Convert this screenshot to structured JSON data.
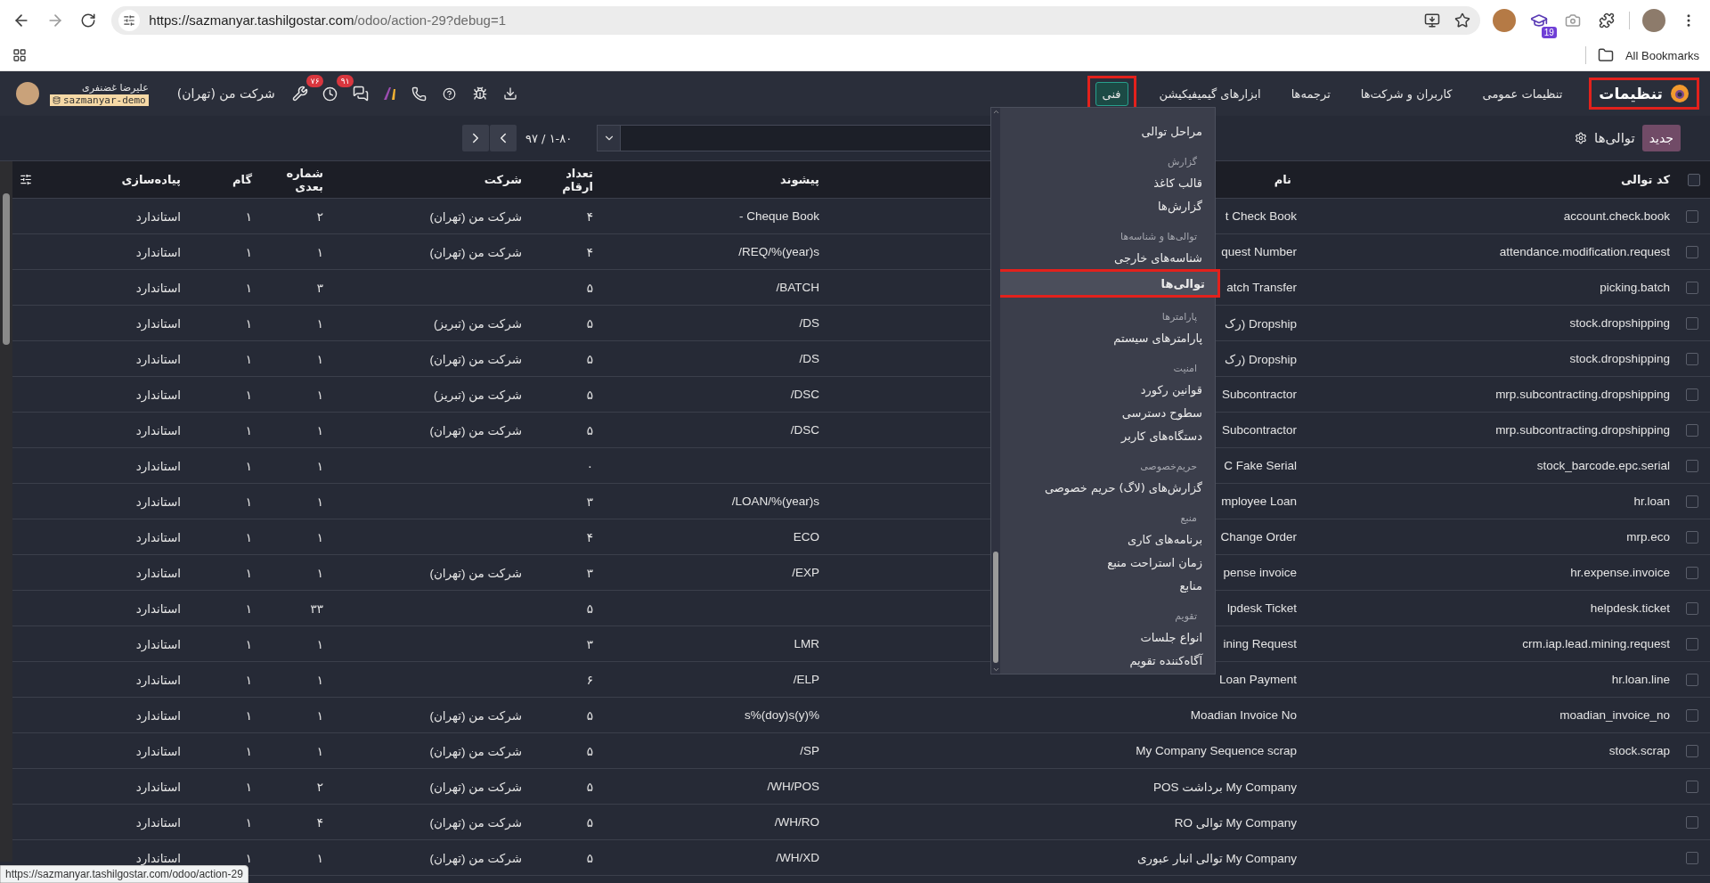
{
  "browser": {
    "url_host": "https://sazmanyar.tashilgostar.com",
    "url_path": "/odoo/action-29?debug=1",
    "extension_badge": "19",
    "bookmarks_label": "All Bookmarks"
  },
  "navbar": {
    "app": {
      "label": "تنظیمات",
      "annotated": true
    },
    "menu": [
      {
        "label": "تنظیمات عمومی",
        "selected": false,
        "annotated": false
      },
      {
        "label": "کاربران و شرکت‌ها",
        "selected": false,
        "annotated": false
      },
      {
        "label": "ترجمه‌ها",
        "selected": false,
        "annotated": false
      },
      {
        "label": "ابزارهای گیمیفیکیشن",
        "selected": false,
        "annotated": false
      },
      {
        "label": "فنی",
        "selected": true,
        "annotated": true
      }
    ],
    "systray": {
      "chat_count": "۹۱",
      "activity_count": "۷۶",
      "company": "شرکت من (تهران)",
      "user_name": "علیرضا غضنفری",
      "database": "sazmanyar-demo"
    }
  },
  "control_panel": {
    "new_button": "جدید",
    "breadcrumb": "توالی‌ها",
    "pager": "۱-۸۰ / ۹۷"
  },
  "menu_dropdown": {
    "items": [
      {
        "kind": "item",
        "label": "مراحل توالی",
        "selected": false,
        "annotated": false
      },
      {
        "kind": "header",
        "label": "گزارش"
      },
      {
        "kind": "item",
        "label": "قالب کاغذ",
        "selected": false,
        "annotated": false
      },
      {
        "kind": "item",
        "label": "گزارش‌ها",
        "selected": false,
        "annotated": false
      },
      {
        "kind": "header",
        "label": "توالی‌ها و شناسه‌ها"
      },
      {
        "kind": "item",
        "label": "شناسه‌های خارجی",
        "selected": false,
        "annotated": false
      },
      {
        "kind": "item",
        "label": "توالی‌ها",
        "selected": true,
        "annotated": true
      },
      {
        "kind": "header",
        "label": "پارامترها"
      },
      {
        "kind": "item",
        "label": "پارامترهای سیستم",
        "selected": false,
        "annotated": false
      },
      {
        "kind": "header",
        "label": "امنیت"
      },
      {
        "kind": "item",
        "label": "قوانین رکورد",
        "selected": false,
        "annotated": false
      },
      {
        "kind": "item",
        "label": "سطوح دسترسی",
        "selected": false,
        "annotated": false
      },
      {
        "kind": "item",
        "label": "دستگاه‌های کاربر",
        "selected": false,
        "annotated": false
      },
      {
        "kind": "header",
        "label": "حریم‌خصوصی"
      },
      {
        "kind": "item",
        "label": "گزارش‌های (لاگ) حریم خصوصی",
        "selected": false,
        "annotated": false
      },
      {
        "kind": "header",
        "label": "منبع"
      },
      {
        "kind": "item",
        "label": "برنامه‌های کاری",
        "selected": false,
        "annotated": false
      },
      {
        "kind": "item",
        "label": "زمان استراحت منبع",
        "selected": false,
        "annotated": false
      },
      {
        "kind": "item",
        "label": "منابع",
        "selected": false,
        "annotated": false
      },
      {
        "kind": "header",
        "label": "تقویم"
      },
      {
        "kind": "item",
        "label": "انواع جلسات",
        "selected": false,
        "annotated": false
      },
      {
        "kind": "item",
        "label": "آگاه‌کننده تقویم",
        "selected": false,
        "annotated": false
      }
    ]
  },
  "table": {
    "select_all_checked": false,
    "columns": [
      "کد توالی",
      "نام",
      "پیشوند",
      "تعداد ارقام",
      "شرکت",
      "شماره بعدی",
      "گام",
      "پیاده‌سازی"
    ],
    "rows": [
      {
        "checked": false,
        "cells": [
          "account.check.book",
          "t Check Book",
          "- Cheque Book",
          "۴",
          "شرکت من (تهران)",
          "۲",
          "۱",
          "استاندارد"
        ]
      },
      {
        "checked": false,
        "cells": [
          "attendance.modification.request",
          "quest Number",
          "/REQ/%(year)s",
          "۴",
          "شرکت من (تهران)",
          "۱",
          "۱",
          "استاندارد"
        ]
      },
      {
        "checked": false,
        "cells": [
          "picking.batch",
          "atch Transfer",
          "/BATCH",
          "۵",
          "",
          "۳",
          "۱",
          "استاندارد"
        ]
      },
      {
        "checked": false,
        "cells": [
          "stock.dropshipping",
          "Dropship (رک",
          "/DS",
          "۵",
          "شرکت من (تبریز)",
          "۱",
          "۱",
          "استاندارد"
        ]
      },
      {
        "checked": false,
        "cells": [
          "stock.dropshipping",
          "Dropship (رک",
          "/DS",
          "۵",
          "شرکت من (تهران)",
          "۱",
          "۱",
          "استاندارد"
        ]
      },
      {
        "checked": false,
        "cells": [
          "mrp.subcontracting.dropshipping",
          "Subcontractor",
          "/DSC",
          "۵",
          "شرکت من (تبریز)",
          "۱",
          "۱",
          "استاندارد"
        ]
      },
      {
        "checked": false,
        "cells": [
          "mrp.subcontracting.dropshipping",
          "Subcontractor",
          "/DSC",
          "۵",
          "شرکت من (تهران)",
          "۱",
          "۱",
          "استاندارد"
        ]
      },
      {
        "checked": false,
        "cells": [
          "stock_barcode.epc.serial",
          "C Fake Serial",
          "",
          "۰",
          "",
          "۱",
          "۱",
          "استاندارد"
        ]
      },
      {
        "checked": false,
        "cells": [
          "hr.loan",
          "mployee Loan",
          "/LOAN/%(year)s",
          "۳",
          "",
          "۱",
          "۱",
          "استاندارد"
        ]
      },
      {
        "checked": false,
        "cells": [
          "mrp.eco",
          "Change Order",
          "ECO",
          "۴",
          "",
          "۱",
          "۱",
          "استاندارد"
        ]
      },
      {
        "checked": false,
        "cells": [
          "hr.expense.invoice",
          "pense invoice",
          "/EXP",
          "۳",
          "شرکت من (تهران)",
          "۱",
          "۱",
          "استاندارد"
        ]
      },
      {
        "checked": false,
        "cells": [
          "helpdesk.ticket",
          "lpdesk Ticket",
          "",
          "۵",
          "",
          "۳۳",
          "۱",
          "استاندارد"
        ]
      },
      {
        "checked": false,
        "cells": [
          "crm.iap.lead.mining.request",
          "ining Request",
          "LMR",
          "۳",
          "",
          "۱",
          "۱",
          "استاندارد"
        ]
      },
      {
        "checked": false,
        "cells": [
          "hr.loan.line",
          "Loan Payment",
          "/ELP",
          "۶",
          "",
          "۱",
          "۱",
          "استاندارد"
        ]
      },
      {
        "checked": false,
        "cells": [
          "moadian_invoice_no",
          "Moadian Invoice No",
          "s%(doy)s(y)%",
          "۵",
          "شرکت من (تهران)",
          "۱",
          "۱",
          "استاندارد"
        ]
      },
      {
        "checked": false,
        "cells": [
          "stock.scrap",
          "My Company Sequence scrap",
          "/SP",
          "۵",
          "شرکت من (تهران)",
          "۱",
          "۱",
          "استاندارد"
        ]
      },
      {
        "checked": false,
        "cells": [
          "",
          "My Company برداشت POS",
          "/WH/POS",
          "۵",
          "شرکت من (تهران)",
          "۲",
          "۱",
          "استاندارد"
        ]
      },
      {
        "checked": false,
        "cells": [
          "",
          "My Company توالی RO",
          "/WH/RO",
          "۵",
          "شرکت من (تهران)",
          "۴",
          "۱",
          "استاندارد"
        ]
      },
      {
        "checked": false,
        "cells": [
          "",
          "My Company توالی انبار عبوری",
          "/WH/XD",
          "۵",
          "شرکت من (تهران)",
          "۱",
          "۱",
          "استاندارد"
        ]
      }
    ]
  },
  "status_url": "https://sazmanyar.tashilgostar.com/odoo/action-29"
}
